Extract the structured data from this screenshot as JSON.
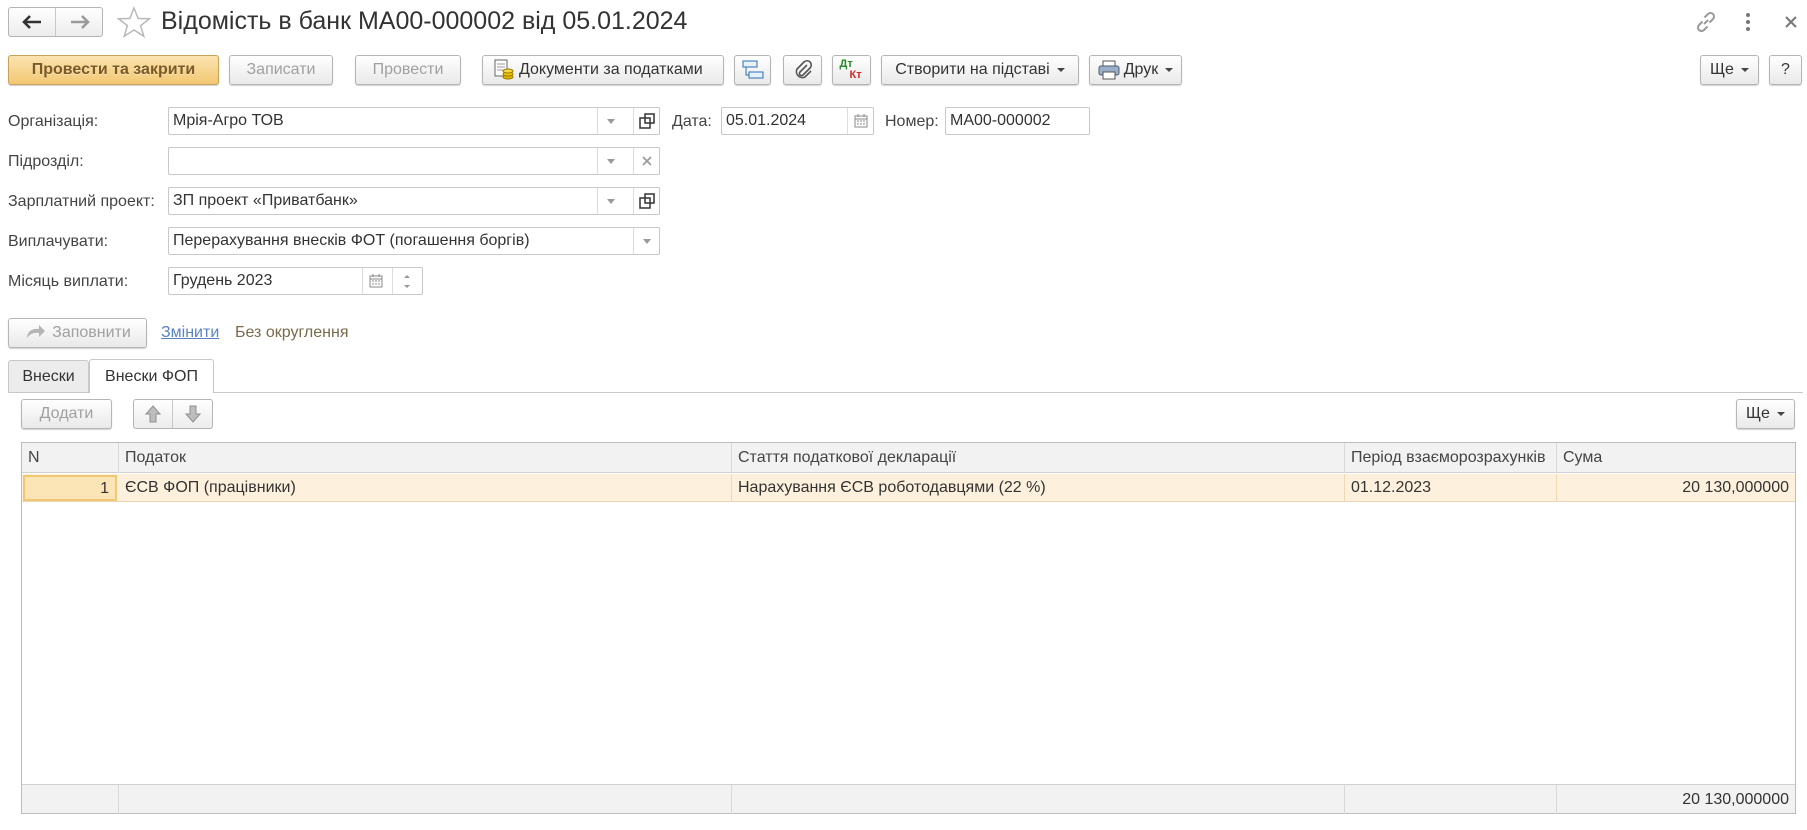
{
  "title": "Відомість в банк МА00-000002 від 05.01.2024",
  "toolbar": {
    "post_close": "Провести та закрити",
    "save": "Записати",
    "post": "Провести",
    "tax_docs": "Документи за податками",
    "create_based": "Створити на підставі",
    "print": "Друк",
    "more": "Ще",
    "help": "?",
    "dt_kt_top": "Дт",
    "dt_kt_bottom": "Кт"
  },
  "form": {
    "org_label": "Організація:",
    "org_value": "Мрія-Агро ТОВ",
    "date_label": "Дата:",
    "date_value": "05.01.2024",
    "number_label": "Номер:",
    "number_value": "МА00-000002",
    "dept_label": "Підрозділ:",
    "dept_value": "",
    "project_label": "Зарплатний проект:",
    "project_value": "ЗП проект «Приватбанк»",
    "pay_label": "Виплачувати:",
    "pay_value": "Перерахування внесків ФОТ (погашення боргів)",
    "month_label": "Місяць виплати:",
    "month_value": "Грудень 2023"
  },
  "actions": {
    "fill": "Заповнити",
    "change": "Змінити",
    "rounding": "Без округлення"
  },
  "tabs": [
    {
      "label": "Внески",
      "active": false
    },
    {
      "label": "Внески ФОП",
      "active": true
    }
  ],
  "table_toolbar": {
    "add": "Додати",
    "more": "Ще"
  },
  "table": {
    "columns": [
      "N",
      "Податок",
      "Стаття податкової декларації",
      "Період взаєморозрахунків",
      "Сума"
    ],
    "rows": [
      [
        "1",
        "ЄСВ ФОП (працівники)",
        "Нарахування ЄСВ роботодавцями (22 %)",
        "01.12.2023",
        "20 130,000000"
      ]
    ],
    "footer_total": "20 130,000000"
  },
  "colors": {
    "primary_button": "#f2c873",
    "selected_row": "#fdf0dc",
    "link": "#5a82c4"
  }
}
